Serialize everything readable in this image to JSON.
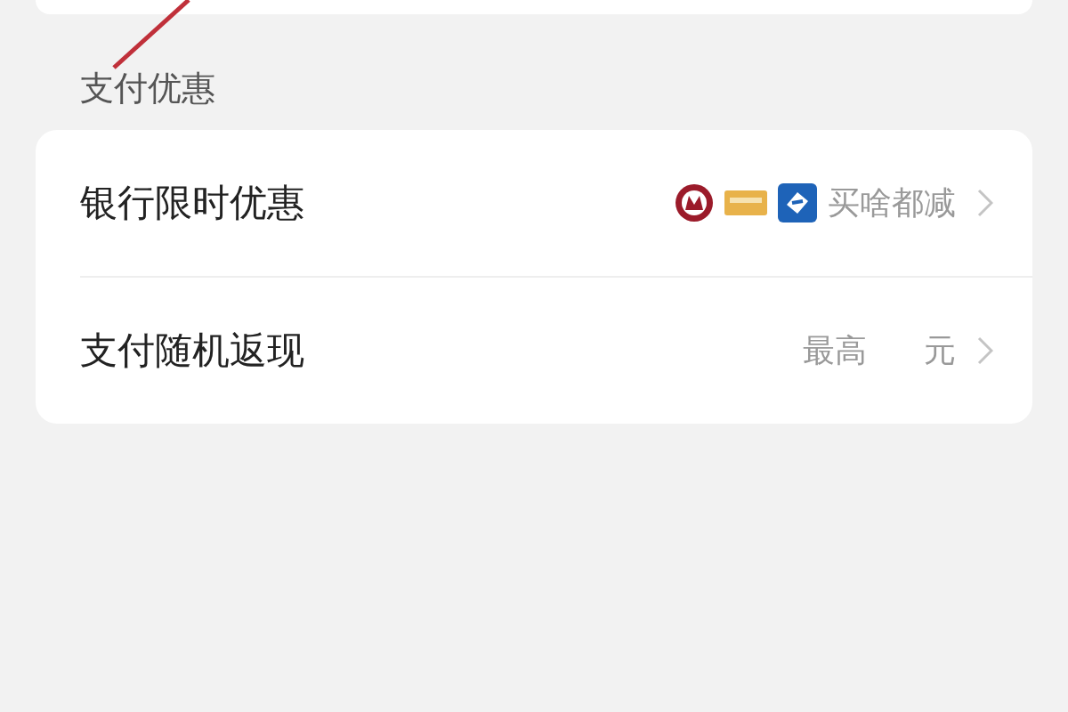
{
  "section_title": "支付优惠",
  "rows": [
    {
      "kind": "banks",
      "label": "银行限时优惠",
      "values": [
        "买啥都减"
      ]
    },
    {
      "kind": "plain",
      "label": "支付随机返现",
      "values": [
        "最高",
        "元"
      ]
    }
  ]
}
